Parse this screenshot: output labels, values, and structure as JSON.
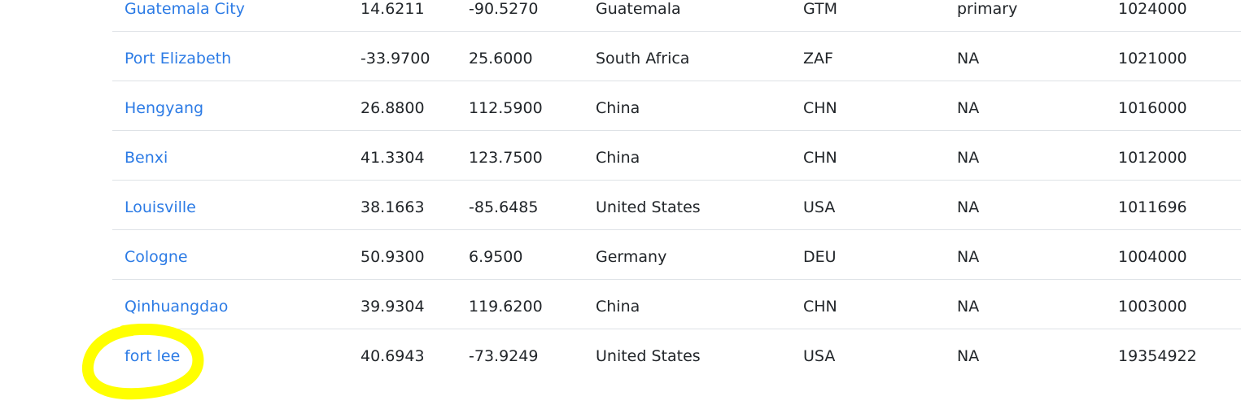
{
  "table": {
    "rows": [
      {
        "city": "Guatemala City",
        "lat": "14.6211",
        "lng": "-90.5270",
        "country": "Guatemala",
        "iso3": "GTM",
        "capital": "primary",
        "population": "1024000"
      },
      {
        "city": "Port Elizabeth",
        "lat": "-33.9700",
        "lng": "25.6000",
        "country": "South Africa",
        "iso3": "ZAF",
        "capital": "NA",
        "population": "1021000"
      },
      {
        "city": "Hengyang",
        "lat": "26.8800",
        "lng": "112.5900",
        "country": "China",
        "iso3": "CHN",
        "capital": "NA",
        "population": "1016000"
      },
      {
        "city": "Benxi",
        "lat": "41.3304",
        "lng": "123.7500",
        "country": "China",
        "iso3": "CHN",
        "capital": "NA",
        "population": "1012000"
      },
      {
        "city": "Louisville",
        "lat": "38.1663",
        "lng": "-85.6485",
        "country": "United States",
        "iso3": "USA",
        "capital": "NA",
        "population": "1011696"
      },
      {
        "city": "Cologne",
        "lat": "50.9300",
        "lng": "6.9500",
        "country": "Germany",
        "iso3": "DEU",
        "capital": "NA",
        "population": "1004000"
      },
      {
        "city": "Qinhuangdao",
        "lat": "39.9304",
        "lng": "119.6200",
        "country": "China",
        "iso3": "CHN",
        "capital": "NA",
        "population": "1003000"
      },
      {
        "city": "fort lee",
        "lat": "40.6943",
        "lng": "-73.9249",
        "country": "United States",
        "iso3": "USA",
        "capital": "NA",
        "population": "19354922"
      }
    ]
  },
  "annotation": {
    "highlight_color": "#ffff00"
  }
}
